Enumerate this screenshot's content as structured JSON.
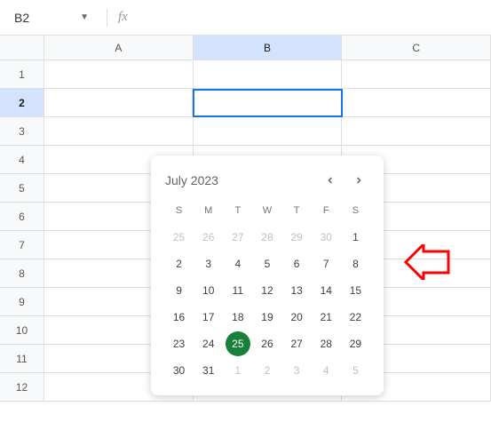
{
  "formula_bar": {
    "cell_ref": "B2",
    "fx_symbol": "fx"
  },
  "columns": [
    "A",
    "B",
    "C"
  ],
  "selected_column_index": 1,
  "rows": [
    "1",
    "2",
    "3",
    "4",
    "5",
    "6",
    "7",
    "8",
    "9",
    "10",
    "11",
    "12"
  ],
  "selected_row_index": 1,
  "datepicker": {
    "title": "July 2023",
    "dow": [
      "S",
      "M",
      "T",
      "W",
      "T",
      "F",
      "S"
    ],
    "days": [
      {
        "d": "25",
        "out": true
      },
      {
        "d": "26",
        "out": true
      },
      {
        "d": "27",
        "out": true
      },
      {
        "d": "28",
        "out": true
      },
      {
        "d": "29",
        "out": true
      },
      {
        "d": "30",
        "out": true
      },
      {
        "d": "1"
      },
      {
        "d": "2"
      },
      {
        "d": "3"
      },
      {
        "d": "4"
      },
      {
        "d": "5"
      },
      {
        "d": "6"
      },
      {
        "d": "7"
      },
      {
        "d": "8"
      },
      {
        "d": "9"
      },
      {
        "d": "10"
      },
      {
        "d": "11"
      },
      {
        "d": "12"
      },
      {
        "d": "13"
      },
      {
        "d": "14"
      },
      {
        "d": "15"
      },
      {
        "d": "16"
      },
      {
        "d": "17"
      },
      {
        "d": "18"
      },
      {
        "d": "19"
      },
      {
        "d": "20"
      },
      {
        "d": "21"
      },
      {
        "d": "22"
      },
      {
        "d": "23"
      },
      {
        "d": "24"
      },
      {
        "d": "25",
        "today": true
      },
      {
        "d": "26"
      },
      {
        "d": "27"
      },
      {
        "d": "28"
      },
      {
        "d": "29"
      },
      {
        "d": "30"
      },
      {
        "d": "31"
      },
      {
        "d": "1",
        "out": true
      },
      {
        "d": "2",
        "out": true
      },
      {
        "d": "3",
        "out": true
      },
      {
        "d": "4",
        "out": true
      },
      {
        "d": "5",
        "out": true
      }
    ]
  },
  "annotation_color": "#ff0000"
}
